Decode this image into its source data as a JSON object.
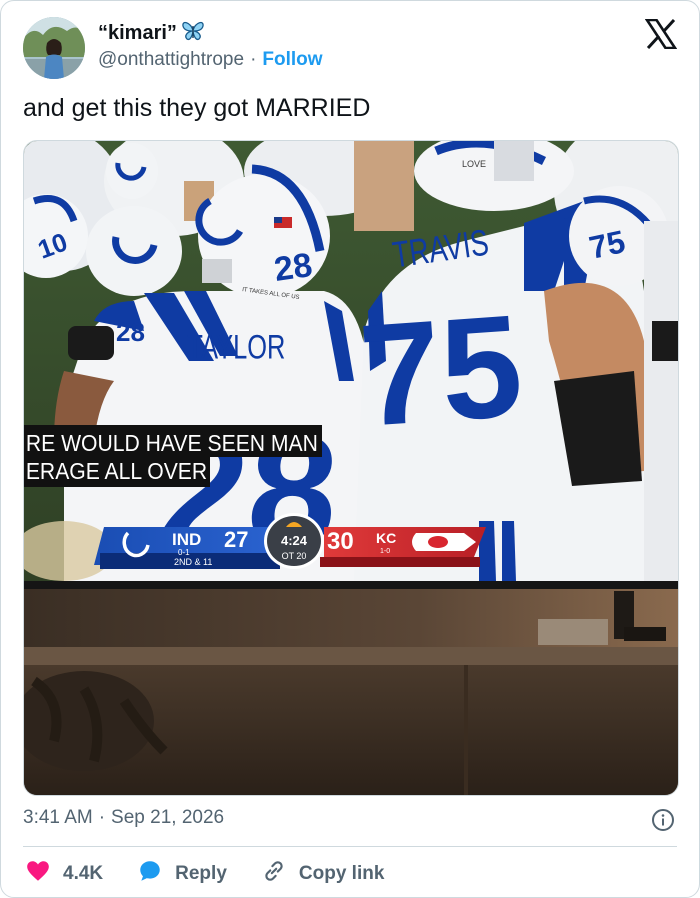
{
  "author": {
    "display_name": "“kimari”",
    "handle": "@onthattightrope",
    "separator": "·",
    "follow_label": "Follow",
    "badge_icon": "butterfly-icon"
  },
  "brand_icon": "x-logo-icon",
  "tweet": {
    "text": "and get this they got MARRIED",
    "time": "3:41 AM",
    "separator": "·",
    "date": "Sep 21, 2026"
  },
  "media": {
    "jersey_left_name": "TAYLOR",
    "jersey_left_number": "28",
    "jersey_right_name": "TRAVIS",
    "jersey_right_number": "75",
    "helmet_left_number": "28",
    "helmet_right_number": "75",
    "helmet_small_number": "10",
    "helmet_text": "IT TAKES ALL OF US",
    "helmet_text_right": "LOVE",
    "caption_line1": "RE WOULD HAVE SEEN MAN",
    "caption_line2": "ERAGE ALL OVER",
    "scoreboard": {
      "home_team": "IND",
      "home_record": "0-1",
      "home_score": "27",
      "clock": "4:24",
      "period": "OT 20",
      "away_score": "30",
      "away_team": "KC",
      "away_record": "1-0",
      "down_distance": "2ND & 11"
    }
  },
  "actions": {
    "like_count": "4.4K",
    "reply_label": "Reply",
    "copy_label": "Copy link"
  },
  "colors": {
    "link": "#1d9bf0",
    "like": "#f91880",
    "reply": "#1d9bf0",
    "muted": "#536471",
    "colts_blue": "#0f3ba3",
    "chiefs_red": "#d8262f"
  }
}
